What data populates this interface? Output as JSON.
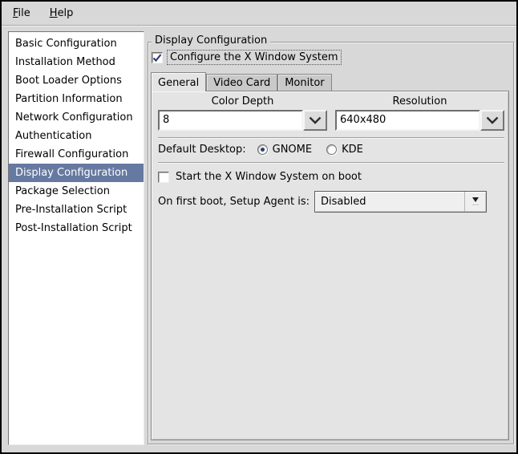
{
  "colors": {
    "selection": "#6679a1",
    "accent-blue": "#2c3e6f",
    "win-bg": "#d8d8d8",
    "page-bg": "#e4e4e4",
    "tab-bg": "#c9c9c9"
  },
  "menubar": {
    "items": [
      {
        "label": "File",
        "accel": "F",
        "rest": "ile"
      },
      {
        "label": "Help",
        "accel": "H",
        "rest": "elp"
      }
    ]
  },
  "sidebar": {
    "items": [
      "Basic Configuration",
      "Installation Method",
      "Boot Loader Options",
      "Partition Information",
      "Network Configuration",
      "Authentication",
      "Firewall Configuration",
      "Display Configuration",
      "Package Selection",
      "Pre-Installation Script",
      "Post-Installation Script"
    ],
    "selected_item": "Display Configuration"
  },
  "panel": {
    "frame_title": "Display Configuration",
    "configure_checkbox": {
      "label": "Configure the X Window System",
      "checked": true
    },
    "tabs": [
      {
        "label": "General",
        "active": true
      },
      {
        "label": "Video Card",
        "active": false
      },
      {
        "label": "Monitor",
        "active": false
      }
    ],
    "general": {
      "color_depth": {
        "label": "Color Depth",
        "value": "8"
      },
      "resolution": {
        "label": "Resolution",
        "value": "640x480"
      },
      "default_desktop": {
        "label": "Default Desktop:",
        "options": [
          {
            "label": "GNOME",
            "selected": true
          },
          {
            "label": "KDE",
            "selected": false
          }
        ]
      },
      "startx_checkbox": {
        "label": "Start the X Window System on boot",
        "checked": false
      },
      "setup_agent": {
        "label": "On first boot, Setup Agent is:",
        "value": "Disabled"
      }
    }
  }
}
